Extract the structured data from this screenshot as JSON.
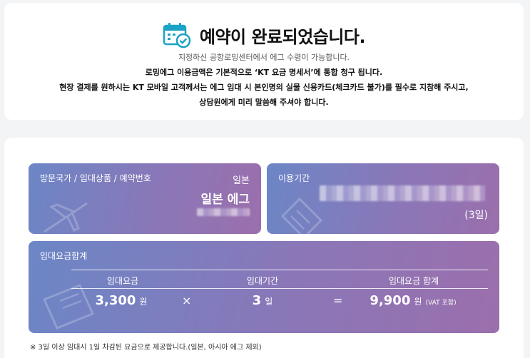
{
  "header": {
    "title": "예약이 완료되었습니다.",
    "subtitle": "지정하신 공항로밍센터에서 에그 수령이 가능합니다.",
    "line2": "로밍에그 이용금액은 기본적으로 ‘KT 요금 명세서’에 통합 청구 됩니다.",
    "line3": "현장 결제를 원하시는 KT 모바일 고객께서는 에그 임대 시 본인명의 실물 신용카드(체크카드 불가)를 필수로 지참해 주시고,",
    "line4": "상담원에게 미리 말씀해 주셔야 합니다.",
    "icon": "calendar-check-icon",
    "icon_color": "#1aa3c4"
  },
  "booking_panel": {
    "label": "방문국가 / 임대상품 / 예약번호",
    "country": "일본",
    "product": "일본 에그"
  },
  "period_panel": {
    "label": "이용기간",
    "days": "(3일)"
  },
  "total_panel": {
    "label": "임대요금합계",
    "columns": [
      "임대요금",
      "임대기간",
      "임대요금 합계"
    ],
    "fee_value": "3,300",
    "fee_unit": "원",
    "multiply": "×",
    "period_value": "3",
    "period_unit": "일",
    "equals": "=",
    "total_value": "9,900",
    "total_unit": "원",
    "vat": "(VAT 포함)"
  },
  "footnote": "※ 3일 이상 임대시 1일 차감된 요금으로 제공합니다.(일본, 아시아 에그 제외)",
  "colors": {
    "panel_gradient_start": "#6c86c6",
    "panel_gradient_end": "#9b6fac"
  }
}
